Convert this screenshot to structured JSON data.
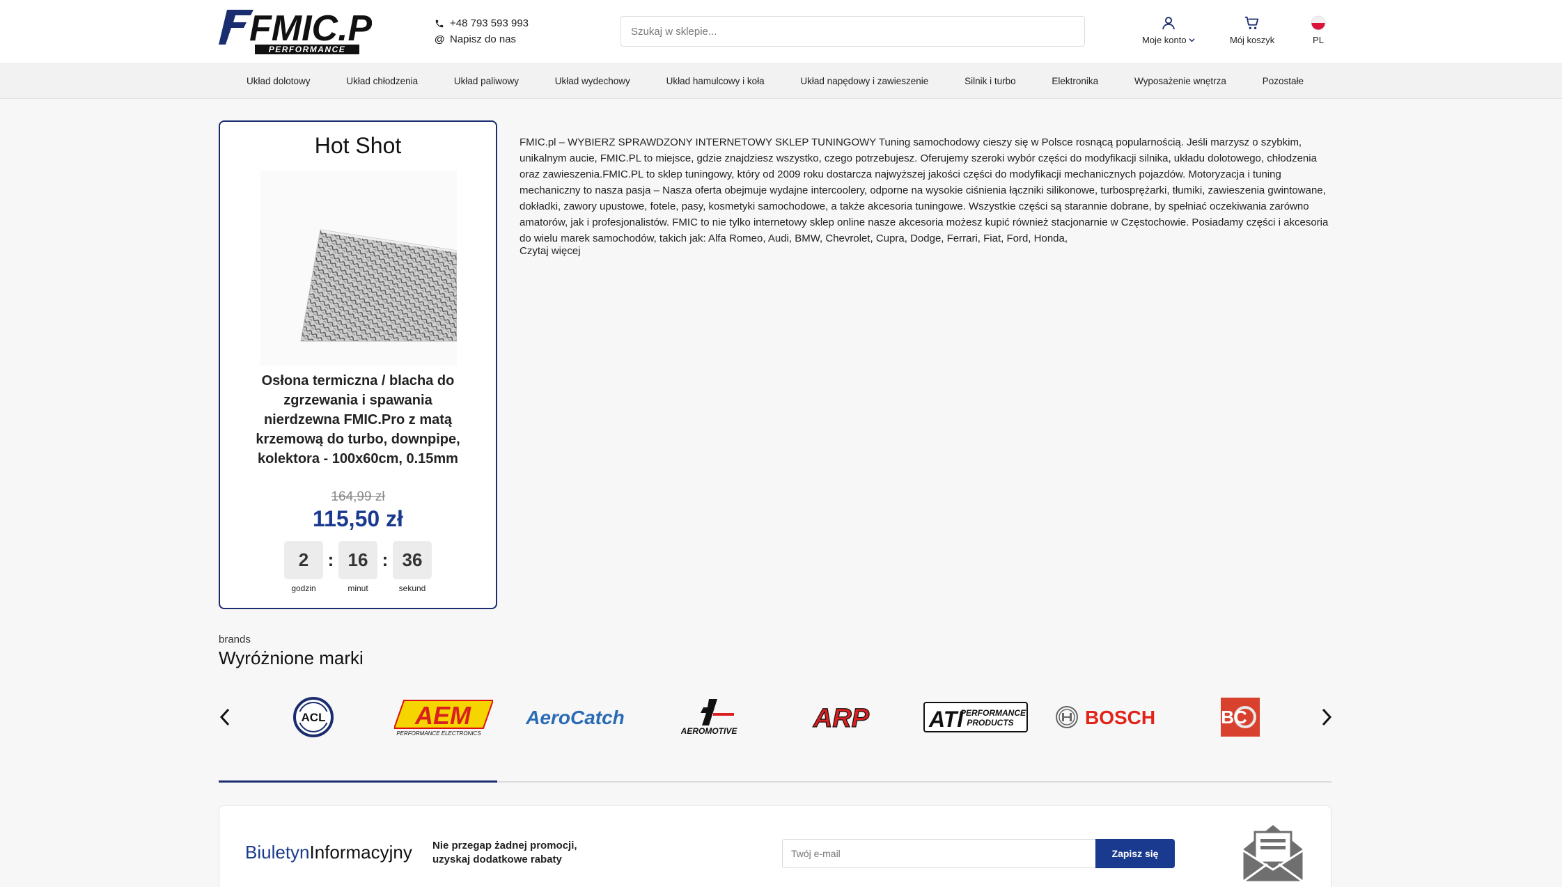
{
  "header": {
    "phone": "+48 793 593 993",
    "write_to_us": "Napisz do nas",
    "search_placeholder": "Szukaj w sklepie...",
    "account_label": "Moje konto",
    "cart_label": "Mój koszyk",
    "lang_label": "PL",
    "logo": {
      "main": "FMIC.PL",
      "sub": "PERFORMANCE"
    }
  },
  "nav": {
    "items": [
      "Układ dolotowy",
      "Układ chłodzenia",
      "Układ paliwowy",
      "Układ wydechowy",
      "Układ hamulcowy i koła",
      "Układ napędowy i zawieszenie",
      "Silnik i turbo",
      "Elektronika",
      "Wyposażenie wnętrza",
      "Pozostałe"
    ]
  },
  "hotshot": {
    "title": "Hot Shot",
    "product_name": "Osłona termiczna / blacha do zgrzewania i spawania nierdzewna FMIC.Pro z matą krzemową do turbo, downpipe, kolektora - 100x60cm, 0.15mm",
    "old_price": "164,99 zł",
    "new_price": "115,50 zł",
    "timer": {
      "hours": "2",
      "minutes": "16",
      "seconds": "36",
      "hours_label": "godzin",
      "minutes_label": "minut",
      "seconds_label": "sekund",
      "separator": ":"
    }
  },
  "description": {
    "text": "FMIC.pl – WYBIERZ SPRAWDZONY INTERNETOWY SKLEP TUNINGOWY  Tuning samochodowy cieszy się w Polsce rosnącą popularnością. Jeśli marzysz o szybkim, unikalnym aucie, FMIC.PL to miejsce, gdzie znajdziesz wszystko, czego potrzebujesz. Oferujemy szeroki wybór części do modyfikacji silnika, układu dolotowego, chłodzenia oraz zawieszenia.FMIC.PL to sklep tuningowy, który od 2009 roku dostarcza najwyższej jakości części do modyfikacji mechanicznych pojazdów. Motoryzacja i tuning mechaniczny to nasza pasja – Nasza oferta obejmuje wydajne intercoolery, odporne na wysokie ciśnienia łączniki silikonowe, turbosprężarki, tłumiki, zawieszenia gwintowane, dokładki, zawory upustowe, fotele, pasy, kosmetyki samochodowe, a także akcesoria tuningowe. Wszystkie części są starannie dobrane, by spełniać oczekiwania zarówno amatorów, jak i profesjonalistów. FMIC to nie tylko internetowy sklep online nasze akcesoria możesz kupić również stacjonarnie w Częstochowie. Posiadamy części i akcesoria do wielu marek samochodów, takich jak: Alfa Romeo, Audi, BMW, Chevrolet, Cupra, Dodge, Ferrari, Fiat, Ford, Honda,",
    "read_more": "Czytaj więcej"
  },
  "brands": {
    "subtitle": "brands",
    "title": "Wyróżnione marki",
    "items": [
      {
        "name": "ACL"
      },
      {
        "name": "AEM",
        "tagline": "PERFORMANCE ELECTRONICS"
      },
      {
        "name": "AeroCatch"
      },
      {
        "name": "AEROMOTIVE"
      },
      {
        "name": "ARP"
      },
      {
        "name": "ATI",
        "tagline1": "PERFORMANCE",
        "tagline2": "PRODUCTS"
      },
      {
        "name": "BOSCH"
      },
      {
        "name": "BC"
      }
    ]
  },
  "newsletter": {
    "title_part1": "Biuletyn",
    "title_part2": "Informacyjny",
    "text_line1": "Nie przegap żadnej promocji,",
    "text_line2": "uzyskaj dodatkowe rabaty",
    "email_placeholder": "Twój e-mail",
    "submit_label": "Zapisz się"
  },
  "colors": {
    "primary": "#1a3a8f",
    "border_dark": "#1a2d6e",
    "aem_yellow": "#f5d400",
    "arp_red": "#d9201f",
    "bosch_red": "#e2231a",
    "bc_red": "#d9412f"
  }
}
